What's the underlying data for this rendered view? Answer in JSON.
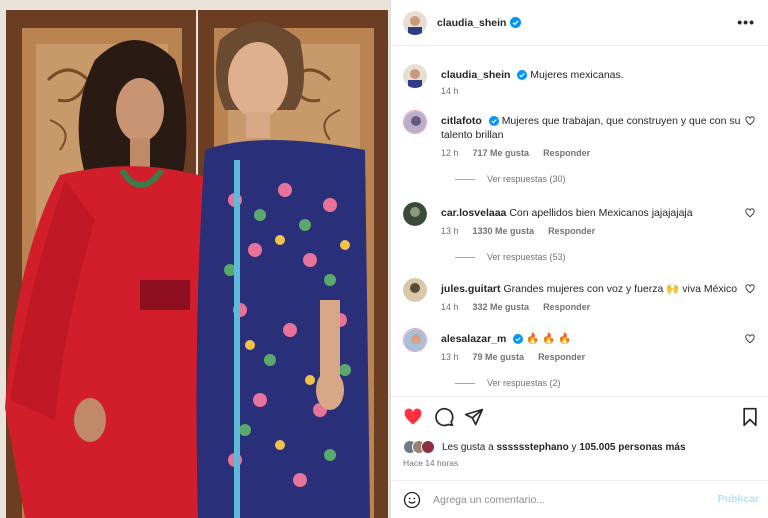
{
  "post": {
    "author": "claudia_shein",
    "caption": "Mujeres mexicanas.",
    "caption_time": "14 h"
  },
  "comments": [
    {
      "user": "citlafoto",
      "verified": true,
      "text": "Mujeres que trabajan, que construyen y que con su talento brillan",
      "time": "12 h",
      "likes": "717 Me gusta",
      "reply": "Responder",
      "replies": "Ver respuestas (30)"
    },
    {
      "user": "car.losvelaaa",
      "verified": false,
      "text": "Con apellidos bien Mexicanos jajajajaja",
      "time": "13 h",
      "likes": "1330 Me gusta",
      "reply": "Responder",
      "replies": "Ver respuestas (53)"
    },
    {
      "user": "jules.guitart",
      "verified": false,
      "text": "Grandes mujeres con voz y fuerza 🙌 viva México",
      "time": "14 h",
      "likes": "332 Me gusta",
      "reply": "Responder",
      "replies": ""
    },
    {
      "user": "alesalazar_m",
      "verified": true,
      "text": "🔥 🔥 🔥",
      "time": "13 h",
      "likes": "79 Me gusta",
      "reply": "Responder",
      "replies": "Ver respuestas (2)"
    }
  ],
  "likes_summary": {
    "prefix": "Les gusta a",
    "user": "sssssstephano",
    "middle": "y",
    "count": "105.005 personas más"
  },
  "timestamp": "Hace 14 horas",
  "comment_box": {
    "placeholder": "Agrega un comentario...",
    "publish": "Publicar"
  },
  "icons": {
    "header_more": "more-options-icon",
    "like": "heart-filled-icon",
    "comment": "comment-bubble-icon",
    "share": "paper-plane-icon",
    "save": "bookmark-icon",
    "emoji": "emoji-smile-icon"
  },
  "colors": {
    "like_red": "#ff3040",
    "verified_blue": "#0095f6",
    "publish_disabled": "#b2dffc"
  }
}
